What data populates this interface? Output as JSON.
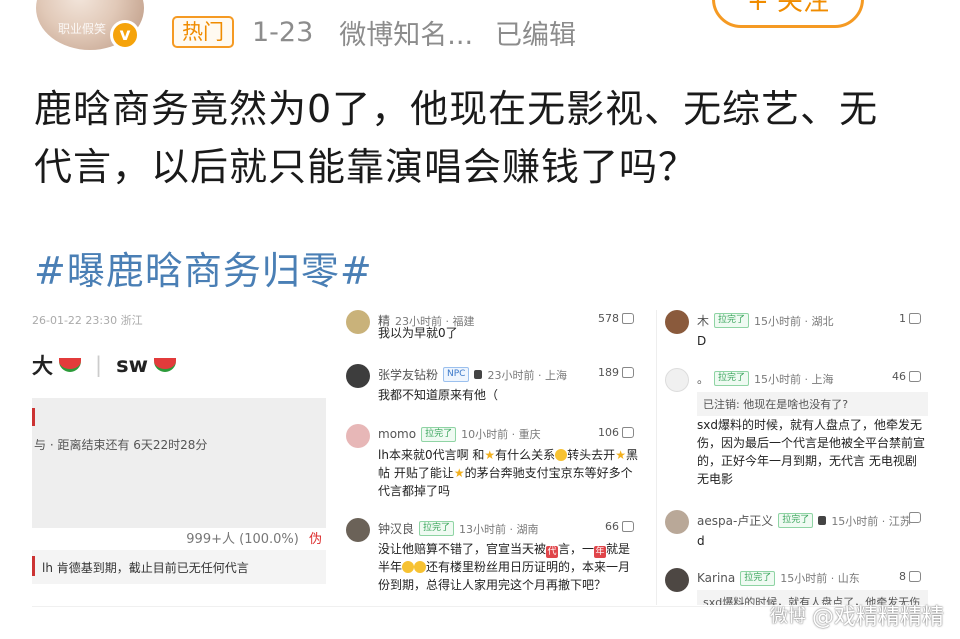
{
  "header": {
    "avatar_caption": "职业假笑",
    "verified_mark": "v",
    "hot_badge": "热门",
    "date": "1-23",
    "source": "微博知名...",
    "edited": "已编辑",
    "follow_label": "+ 关注"
  },
  "post": {
    "text": "鹿晗商务竟然为0了，他现在无影视、无综艺、无代言，以后就只能靠演唱会赚钱了吗？",
    "hashtag": "#曝鹿晗商务归零#"
  },
  "panel1": {
    "timestamp": "26-01-22 23:30 浙江",
    "name_left": "大",
    "name_right": "sw",
    "countdown": "与 · 距离结束还有 6天22时28分",
    "vote_count": "999+人 (100.0%)",
    "vote_clip": "伪",
    "expire_text": "lh 肯德基到期，截止目前已无任何代言"
  },
  "panel2": {
    "comments": [
      {
        "user": "精",
        "time": "23小时前 · 福建",
        "likes": "578",
        "body": "我以为早就0了"
      },
      {
        "user": "张学友钻粉",
        "tag": "NPC",
        "time": "23小时前 · 上海",
        "likes": "189",
        "body": "我都不知道原来有他（"
      },
      {
        "user": "momo",
        "tag": "拉完了",
        "time": "10小时前 · 重庆",
        "likes": "106",
        "body_a": "lh本来就0代言啊 和",
        "body_b": "有什么关系",
        "body_c": "转头去开",
        "body_d": "黑帖 开贴了能让",
        "body_e": "的茅台奔驰支付宝京东等好多个代言都掉了吗"
      },
      {
        "user": "钟汉良",
        "tag": "拉完了",
        "time": "13小时前 · 湖南",
        "likes": "66",
        "body_a": "没让他赔算不错了，官宣当天被",
        "box1": "代",
        "body_b": "言，一",
        "box2": "年",
        "body_c": "就是半年",
        "body_d": "还有楼里粉丝用日历证明的，本来一月份到期，总得让人家用完这个月再撤下吧？"
      }
    ]
  },
  "panel3": {
    "comments": [
      {
        "user": "木",
        "tag": "拉完了",
        "time": "15小时前 · 湖北",
        "likes": "1",
        "body": "D"
      },
      {
        "user": "。",
        "tag": "拉完了",
        "time": "15小时前 · 上海",
        "likes": "46",
        "quote": "已注销: 他现在是啥也没有了?",
        "body": "sxd爆料的时候，就有人盘点了，他牵发无伤，因为最后一个代言是他被全平台禁前宣的，正好今年一月到期，无代言 无电视剧无电影"
      },
      {
        "user": "aespa-卢正义",
        "tag": "拉完了",
        "time": "15小时前 · 江苏",
        "likes": "",
        "body": "d"
      },
      {
        "user": "Karina",
        "tag": "拉完了",
        "time": "15小时前 · 山东",
        "likes": "8",
        "quote": "sxd爆料的时候，就有人盘点了，他牵发无伤"
      }
    ]
  },
  "watermark": {
    "logo": "微博",
    "handle": "@戏精精精精"
  }
}
